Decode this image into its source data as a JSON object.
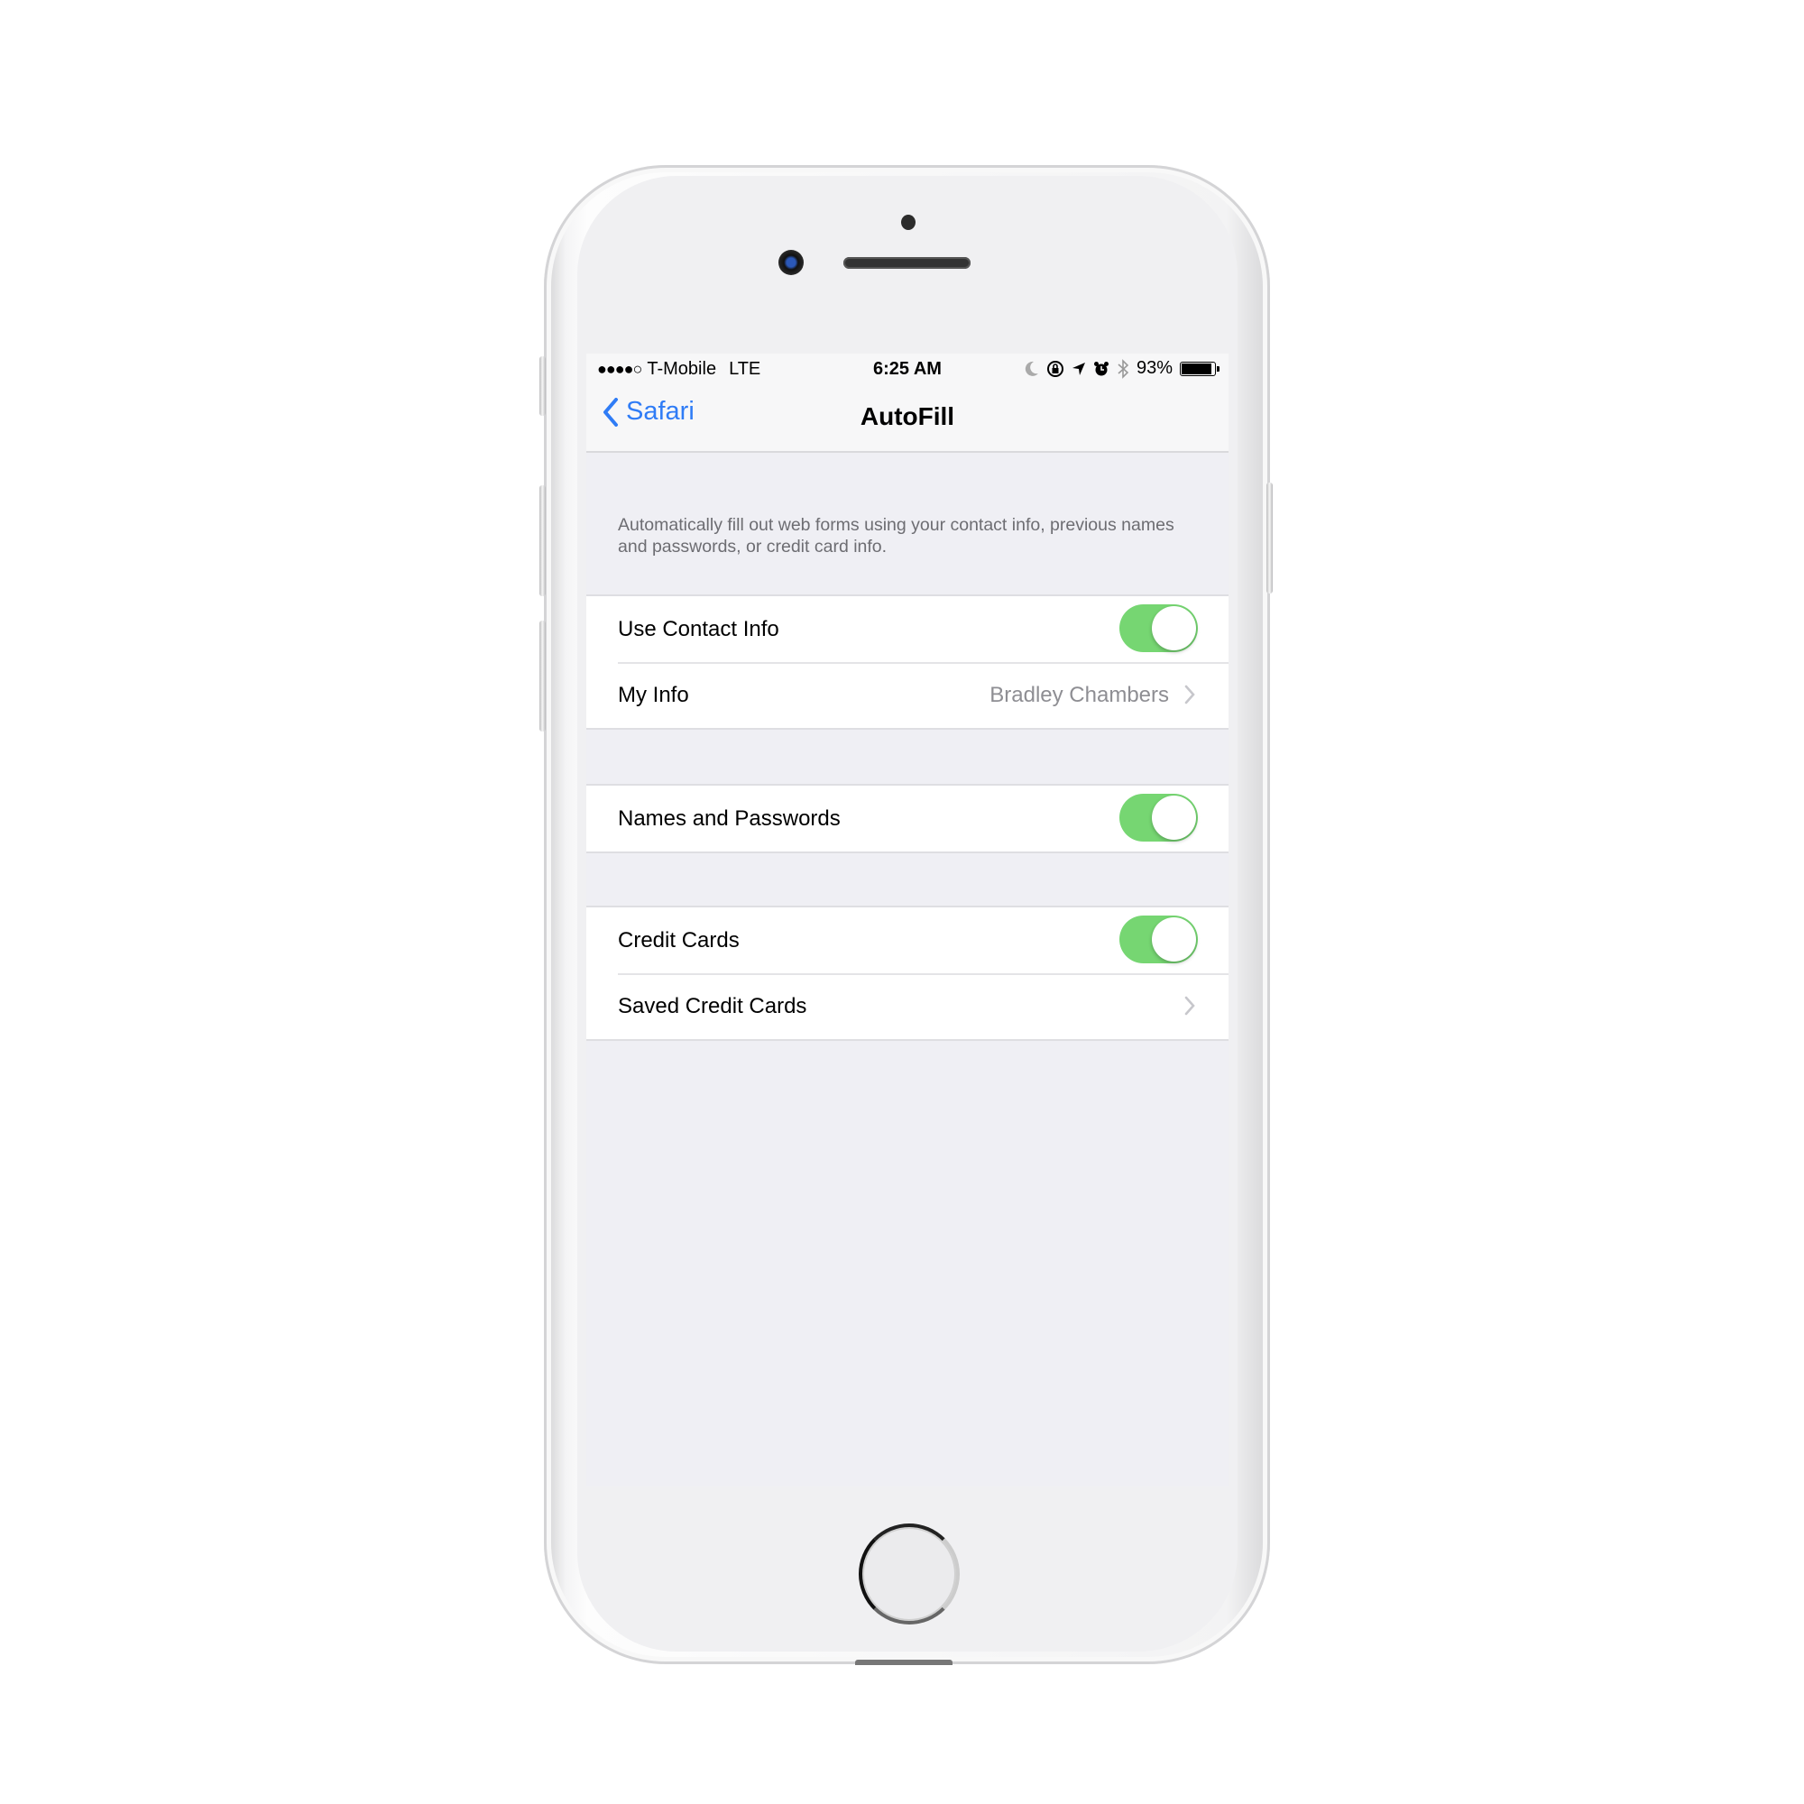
{
  "status_bar": {
    "signal": "●●●●○",
    "carrier": "T-Mobile",
    "network": "LTE",
    "time": "6:25 AM",
    "icons": [
      "moon-icon",
      "orientation-lock-icon",
      "location-icon",
      "alarm-icon",
      "bluetooth-icon"
    ],
    "battery_percent": "93%",
    "battery_level": 0.93
  },
  "nav": {
    "back_label": "Safari",
    "title": "AutoFill"
  },
  "description": "Automatically fill out web forms using your contact info, previous names and passwords, or credit card info.",
  "groups": [
    {
      "rows": [
        {
          "label": "Use Contact Info",
          "type": "toggle",
          "on": true
        },
        {
          "label": "My Info",
          "type": "disclosure",
          "value": "Bradley Chambers"
        }
      ]
    },
    {
      "rows": [
        {
          "label": "Names and Passwords",
          "type": "toggle",
          "on": true
        }
      ]
    },
    {
      "rows": [
        {
          "label": "Credit Cards",
          "type": "toggle",
          "on": true
        },
        {
          "label": "Saved Credit Cards",
          "type": "disclosure",
          "value": ""
        }
      ]
    }
  ],
  "colors": {
    "accent": "#2f7cf6",
    "toggle_on": "#76d672",
    "background": "#efeff4",
    "secondary_text": "#8e8e93"
  }
}
